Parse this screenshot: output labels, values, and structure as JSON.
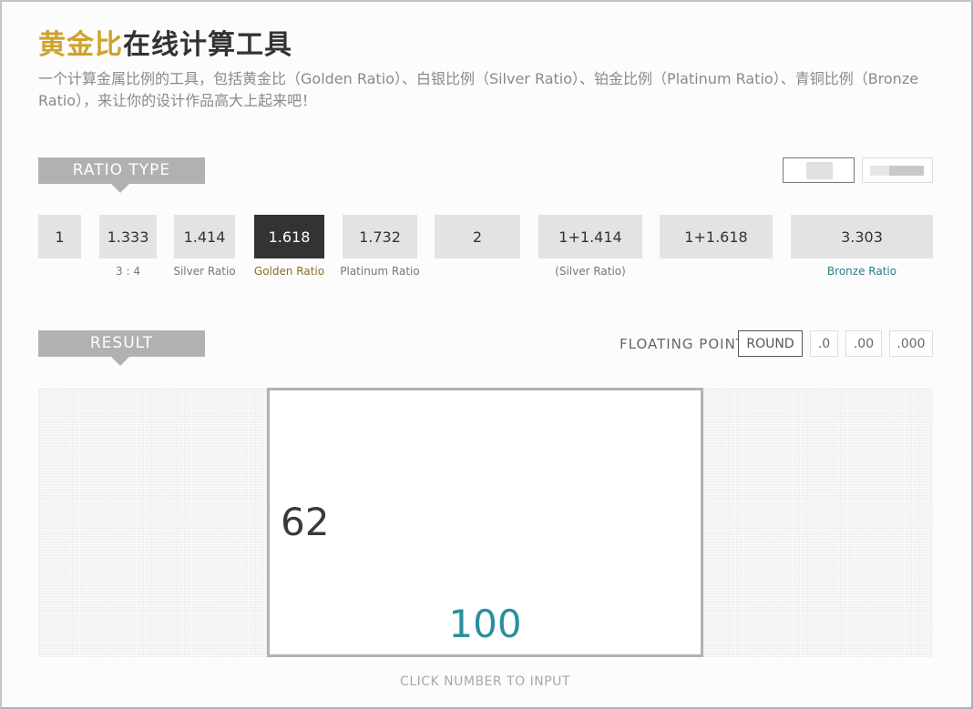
{
  "header": {
    "title_gold": "黄金比",
    "title_rest": "在线计算工具",
    "description": "一个计算金属比例的工具，包括黄金比（Golden Ratio）、白银比例（Silver Ratio）、铂金比例（Platinum Ratio）、青铜比例（Bronze Ratio），来让你的设计作品高大上起来吧！"
  },
  "ratio_section": {
    "label": "RATIO TYPE",
    "orientation": {
      "selected": "portrait"
    },
    "buttons": [
      {
        "value": "1",
        "caption": ""
      },
      {
        "value": "1.333",
        "caption": "3 : 4"
      },
      {
        "value": "1.414",
        "caption": "Silver Ratio"
      },
      {
        "value": "1.618",
        "caption": "Golden Ratio",
        "active": true
      },
      {
        "value": "1.732",
        "caption": "Platinum Ratio"
      },
      {
        "value": "2",
        "caption": ""
      },
      {
        "value": "1+1.414",
        "caption": "(Silver Ratio)"
      },
      {
        "value": "1+1.618",
        "caption": ""
      },
      {
        "value": "3.303",
        "caption": "Bronze Ratio"
      }
    ],
    "colors": {
      "active_bg": "#333333",
      "golden_caption": "#8a6d26",
      "bronze_caption": "#2a7f8a"
    }
  },
  "result_section": {
    "label": "RESULT",
    "floating_point_label": "FLOATING POINT",
    "fp_options": [
      "ROUND",
      ".0",
      ".00",
      ".000"
    ],
    "fp_selected": "ROUND",
    "height_value": "62",
    "width_value": "100",
    "hint": "CLICK NUMBER TO INPUT",
    "colors": {
      "width_number": "#2a8ea0",
      "accent": "#d0a22c"
    }
  }
}
